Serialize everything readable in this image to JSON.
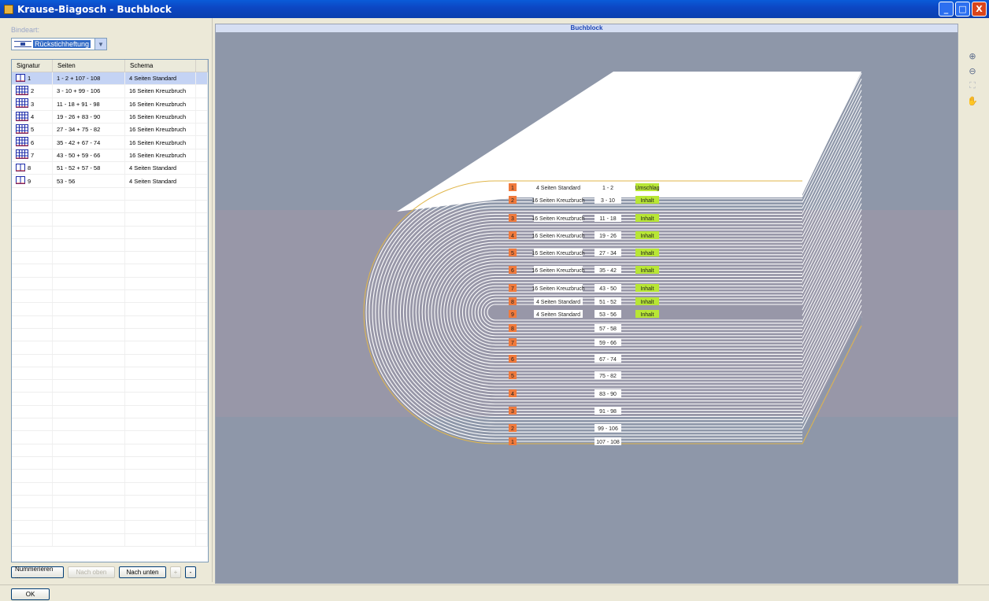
{
  "window": {
    "title": "Krause-Biagosch - Buchblock",
    "buttons": [
      "_",
      "□",
      "X"
    ]
  },
  "left": {
    "bindeart_label": "Bindeart:",
    "bindeart_value": "Rückstichheftung",
    "table": {
      "headers": [
        "Signatur",
        "Seiten",
        "Schema"
      ],
      "rows": [
        {
          "sig": "1",
          "seiten": "1 - 2 + 107 - 108",
          "schema": "4 Seiten Standard",
          "icon": "4-page-icon",
          "selected": true
        },
        {
          "sig": "2",
          "seiten": "3 - 10 + 99 - 106",
          "schema": "16 Seiten Kreuzbruch",
          "icon": "16-page-icon",
          "selected": false
        },
        {
          "sig": "3",
          "seiten": "11 - 18 + 91 - 98",
          "schema": "16 Seiten Kreuzbruch",
          "icon": "16-page-icon",
          "selected": false
        },
        {
          "sig": "4",
          "seiten": "19 - 26 + 83 - 90",
          "schema": "16 Seiten Kreuzbruch",
          "icon": "16-page-icon",
          "selected": false
        },
        {
          "sig": "5",
          "seiten": "27 - 34 + 75 - 82",
          "schema": "16 Seiten Kreuzbruch",
          "icon": "16-page-icon",
          "selected": false
        },
        {
          "sig": "6",
          "seiten": "35 - 42 + 67 - 74",
          "schema": "16 Seiten Kreuzbruch",
          "icon": "16-page-icon",
          "selected": false
        },
        {
          "sig": "7",
          "seiten": "43 - 50 + 59 - 66",
          "schema": "16 Seiten Kreuzbruch",
          "icon": "16-page-icon",
          "selected": false
        },
        {
          "sig": "8",
          "seiten": "51 - 52 + 57 - 58",
          "schema": "4 Seiten Standard",
          "icon": "4-page-icon",
          "selected": false
        },
        {
          "sig": "9",
          "seiten": "53 - 56",
          "schema": "4 Seiten Standard",
          "icon": "4-page-icon",
          "selected": false
        }
      ]
    },
    "buttons": {
      "nummerieren": "Nummerieren ...",
      "nach_oben": "Nach oben",
      "nach_unten": "Nach unten",
      "plus": "+",
      "minus": "-"
    }
  },
  "main": {
    "header": "Buchblock",
    "upper_labels": [
      {
        "num": "1",
        "schema": "4 Seiten Standard",
        "pages": "1 - 2",
        "tag": "Umschlag"
      },
      {
        "num": "2",
        "schema": "16 Seiten Kreuzbruch",
        "pages": "3 - 10",
        "tag": "Inhalt"
      },
      {
        "num": "3",
        "schema": "16 Seiten Kreuzbruch",
        "pages": "11 - 18",
        "tag": "Inhalt"
      },
      {
        "num": "4",
        "schema": "16 Seiten Kreuzbruch",
        "pages": "19 - 26",
        "tag": "Inhalt"
      },
      {
        "num": "5",
        "schema": "16 Seiten Kreuzbruch",
        "pages": "27 - 34",
        "tag": "Inhalt"
      },
      {
        "num": "6",
        "schema": "16 Seiten Kreuzbruch",
        "pages": "35 - 42",
        "tag": "Inhalt"
      },
      {
        "num": "7",
        "schema": "16 Seiten Kreuzbruch",
        "pages": "43 - 50",
        "tag": "Inhalt"
      },
      {
        "num": "8",
        "schema": "4 Seiten Standard",
        "pages": "51 - 52",
        "tag": "Inhalt"
      },
      {
        "num": "9",
        "schema": "4 Seiten Standard",
        "pages": "53 - 56",
        "tag": "Inhalt"
      }
    ],
    "lower_labels": [
      {
        "num": "8",
        "pages": "57 - 58"
      },
      {
        "num": "7",
        "pages": "59 - 66"
      },
      {
        "num": "6",
        "pages": "67 - 74"
      },
      {
        "num": "5",
        "pages": "75 - 82"
      },
      {
        "num": "4",
        "pages": "83 - 90"
      },
      {
        "num": "3",
        "pages": "91 - 98"
      },
      {
        "num": "2",
        "pages": "99 - 106"
      },
      {
        "num": "1",
        "pages": "107 - 108"
      }
    ],
    "colors": {
      "background": "#8e97a9",
      "highlight_band": "#9a96a8",
      "number_box": "#f07a3c",
      "tag_box": "#b8e635",
      "cover_line": "#e0b64a"
    }
  },
  "tools": [
    "zoom-in-icon",
    "zoom-out-icon",
    "fit-icon",
    "pan-icon"
  ],
  "footer": {
    "ok": "OK"
  }
}
